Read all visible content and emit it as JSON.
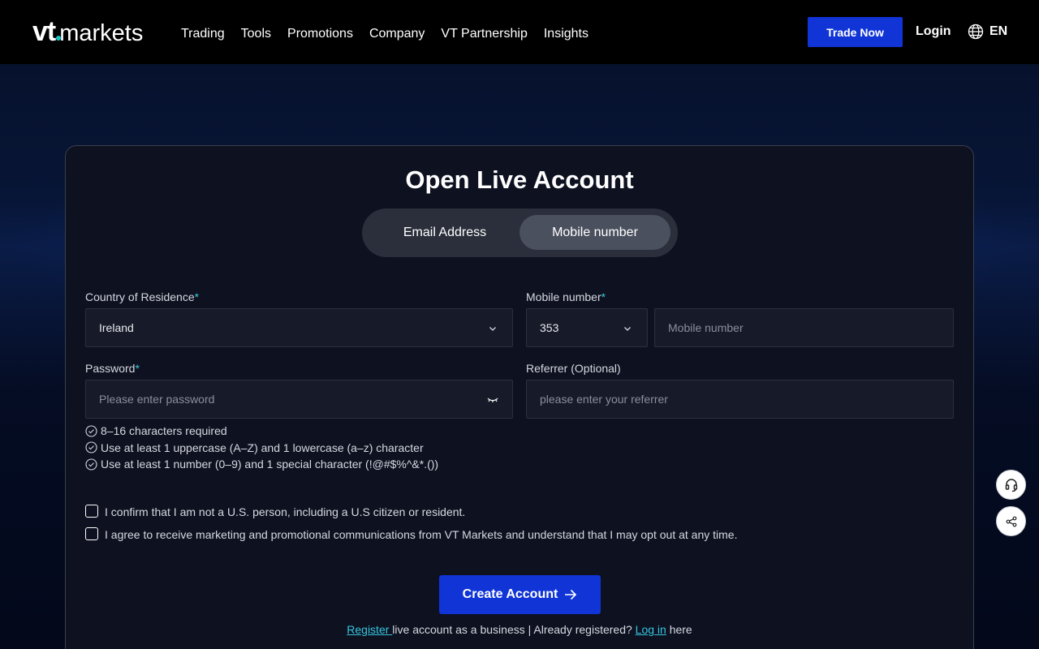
{
  "header": {
    "logo_vt": "vt",
    "logo_markets": "markets",
    "nav": [
      "Trading",
      "Tools",
      "Promotions",
      "Company",
      "VT Partnership",
      "Insights"
    ],
    "trade_now": "Trade Now",
    "login": "Login",
    "language": "EN"
  },
  "form": {
    "title": "Open Live Account",
    "tabs": {
      "email": "Email Address",
      "mobile": "Mobile number",
      "active": "mobile"
    },
    "country": {
      "label": "Country of Residence",
      "required": "*",
      "value": "Ireland"
    },
    "mobile": {
      "label": "Mobile number",
      "required": "*",
      "code": "353",
      "placeholder": "Mobile number"
    },
    "password": {
      "label": "Password",
      "required": "*",
      "placeholder": "Please enter password"
    },
    "referrer": {
      "label": "Referrer (Optional)",
      "placeholder": "please enter your referrer"
    },
    "rules": [
      "8–16 characters required",
      "Use at least 1 uppercase (A–Z) and 1 lowercase (a–z) character",
      "Use at least 1 number (0–9) and 1 special character (!@#$%^&*.())"
    ],
    "checkboxes": [
      "I confirm that I am not a U.S. person, including a U.S citizen or resident.",
      "I agree to receive marketing and promotional communications from VT Markets and understand that I may opt out at any time."
    ],
    "create_button": "Create Account",
    "bottom": {
      "register_link": "Register ",
      "middle_text": "live account as a business | Already registered? ",
      "login_link": "Log in",
      "end_text": " here"
    }
  },
  "colors": {
    "accent": "#1034d6",
    "link": "#38c6e0",
    "required": "#39c7d6"
  },
  "icons": [
    "globe-icon",
    "chevron-down-icon",
    "eye-closed-icon",
    "check-circle-icon",
    "arrow-right-icon",
    "headset-icon",
    "share-icon"
  ]
}
